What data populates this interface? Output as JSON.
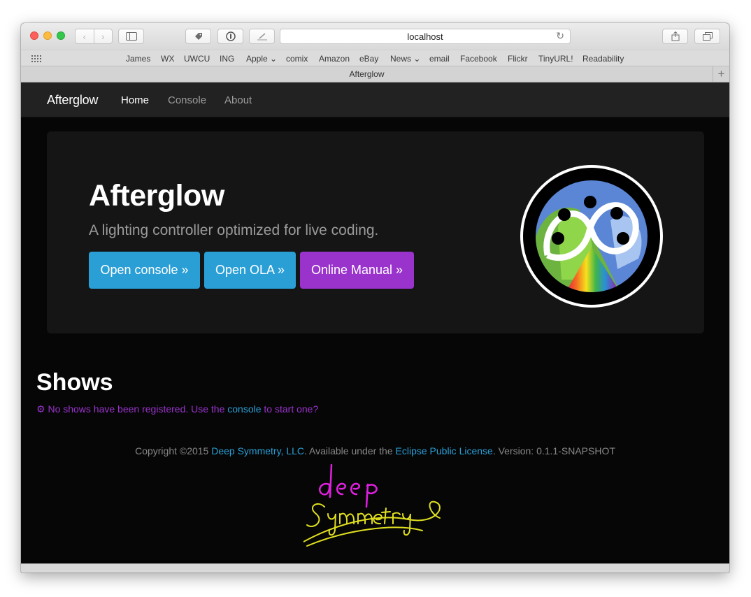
{
  "browser": {
    "address": "localhost",
    "tab_title": "Afterglow",
    "bookmarks": [
      "James",
      "WX",
      "UWCU",
      "ING",
      "Apple ⌄",
      "comix",
      "Amazon",
      "eBay",
      "News ⌄",
      "email",
      "Facebook",
      "Flickr",
      "TinyURL!",
      "Readability"
    ]
  },
  "navbar": {
    "brand": "Afterglow",
    "links": [
      "Home",
      "Console",
      "About"
    ],
    "active": "Home"
  },
  "jumbotron": {
    "title": "Afterglow",
    "subtitle": "A lighting controller optimized for live coding.",
    "buttons": [
      "Open console »",
      "Open OLA »",
      "Online Manual »"
    ]
  },
  "shows": {
    "title": "Shows",
    "message_prefix": "No shows have been registered. Use the ",
    "message_link": "console",
    "message_suffix": " to start one?"
  },
  "footer": {
    "text1": "Copyright ©2015 ",
    "link1": "Deep Symmetry, LLC",
    "text2": ". Available under the ",
    "link2": "Eclipse Public License",
    "text3": ". Version: 0.1.1-SNAPSHOT"
  },
  "colors": {
    "accent_blue": "#2a9fd6",
    "accent_purple": "#9933cc",
    "navbar_bg": "#222222",
    "jumbotron_bg": "#151515"
  }
}
